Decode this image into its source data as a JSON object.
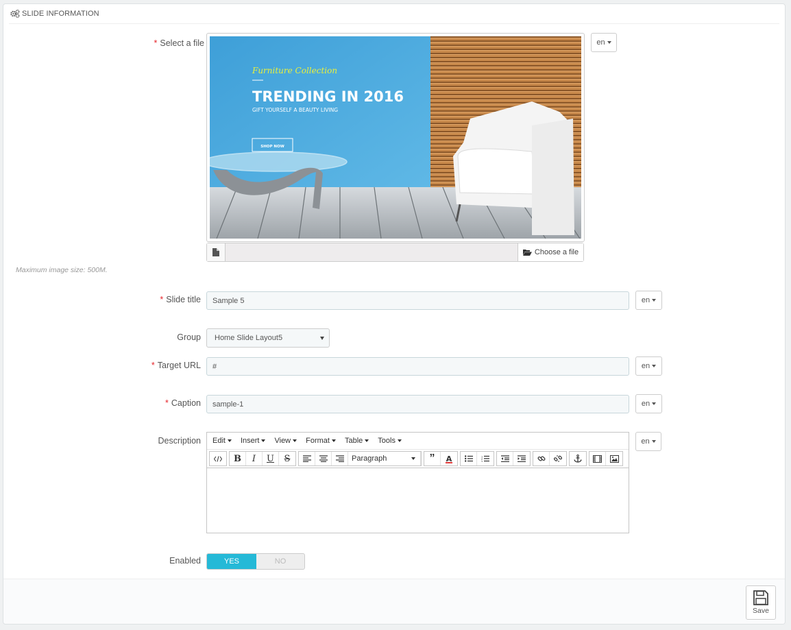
{
  "panel": {
    "heading": "SLIDE INFORMATION"
  },
  "fields": {
    "file": {
      "label": "Select a file",
      "required": "*",
      "lang": "en",
      "choose_label": "Choose a file",
      "help": "Maximum image size: 500M."
    },
    "slide_title": {
      "label": "Slide title",
      "required": "*",
      "value": "Sample 5",
      "lang": "en"
    },
    "group": {
      "label": "Group",
      "selected": "Home Slide Layout5"
    },
    "target_url": {
      "label": "Target URL",
      "required": "*",
      "value": "#",
      "lang": "en"
    },
    "caption": {
      "label": "Caption",
      "required": "*",
      "value": "sample-1",
      "lang": "en"
    },
    "description": {
      "label": "Description",
      "lang": "en"
    },
    "enabled": {
      "label": "Enabled",
      "yes": "YES",
      "no": "NO",
      "value": "YES"
    }
  },
  "banner": {
    "script_title": "Furniture Collection",
    "headline": "TRENDING IN 2016",
    "subline": "GIFT YOURSELF A BEAUTY LIVING",
    "cta": "SHOP NOW"
  },
  "editor": {
    "menus": [
      "Edit",
      "Insert",
      "View",
      "Format",
      "Table",
      "Tools"
    ],
    "block_format": "Paragraph",
    "toolbar_icons": [
      "source-code-icon",
      "bold-icon",
      "italic-icon",
      "underline-icon",
      "strikethrough-icon",
      "align-left-icon",
      "align-center-icon",
      "align-right-icon",
      "blockquote-icon",
      "text-color-icon",
      "bullet-list-icon",
      "numbered-list-icon",
      "outdent-icon",
      "indent-icon",
      "link-icon",
      "unlink-icon",
      "anchor-icon",
      "media-icon",
      "image-icon"
    ]
  },
  "footer": {
    "save_label": "Save"
  },
  "colors": {
    "accent": "#25b9d7",
    "required": "#e6242a",
    "banner_blue": "#4aaee0"
  }
}
